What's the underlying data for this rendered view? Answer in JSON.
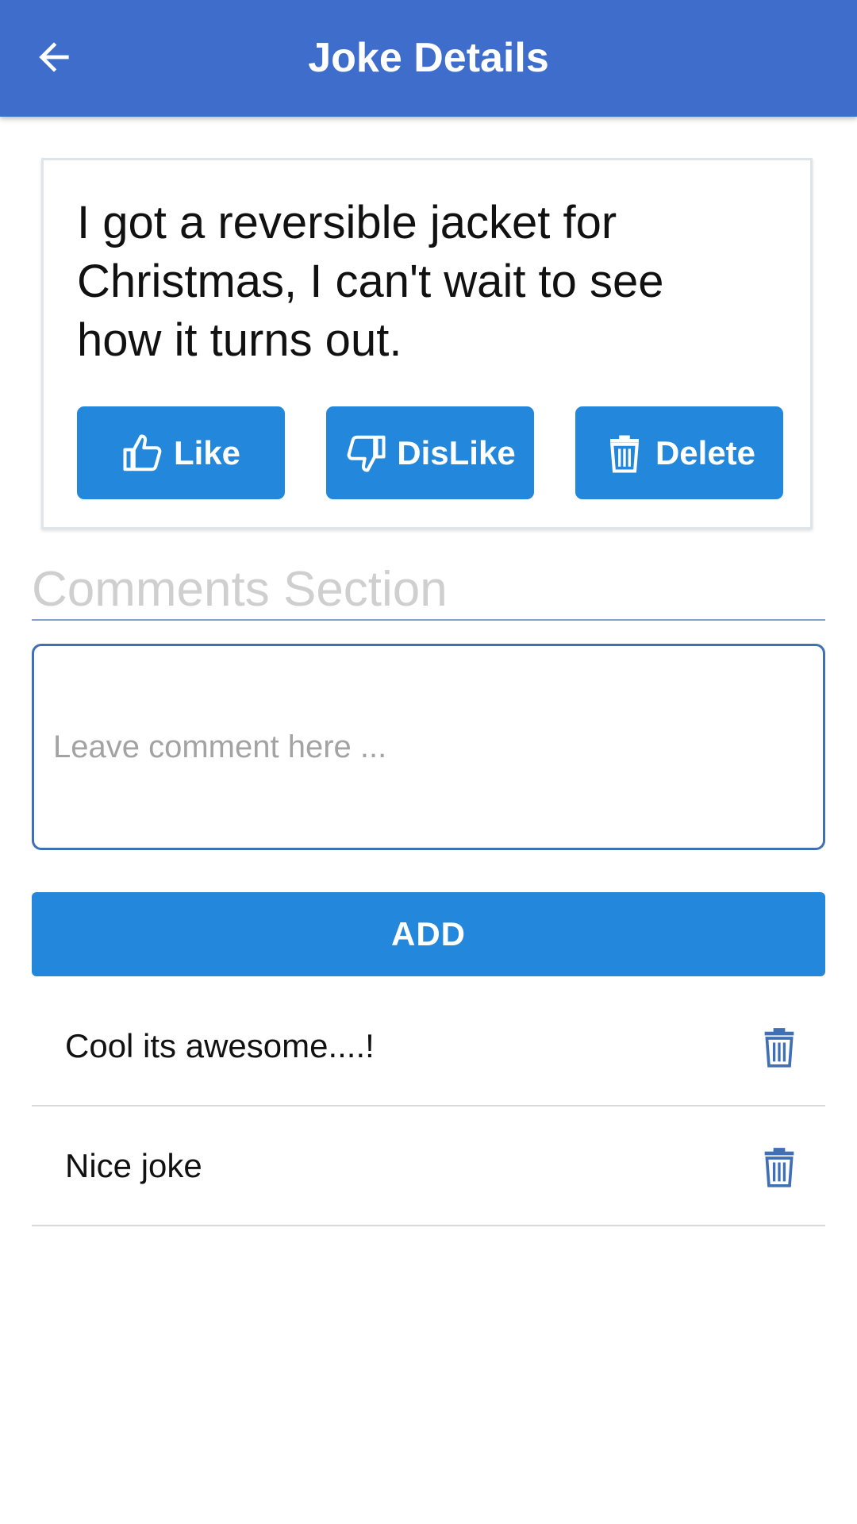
{
  "appbar": {
    "title": "Joke Details",
    "back_icon": "arrow-left-icon",
    "background": "#3e6dcb"
  },
  "joke": {
    "text": "I got a reversible jacket for Christmas, I can't wait to see how it turns out.",
    "actions": {
      "like_label": "Like",
      "like_icon": "thumbs-up-icon",
      "dislike_label": "DisLike",
      "dislike_icon": "thumbs-down-icon",
      "delete_label": "Delete",
      "delete_icon": "trash-icon"
    }
  },
  "comments": {
    "heading": "Comments Section",
    "input": {
      "value": "",
      "placeholder": "Leave comment here ..."
    },
    "add_label": "ADD",
    "items": [
      {
        "text": "Cool its awesome....!",
        "delete_icon": "trash-icon"
      },
      {
        "text": "Nice joke",
        "delete_icon": "trash-icon"
      }
    ]
  },
  "colors": {
    "primary": "#2388db",
    "appbar": "#3e6dcb",
    "icon_blue": "#3f6fb5"
  }
}
